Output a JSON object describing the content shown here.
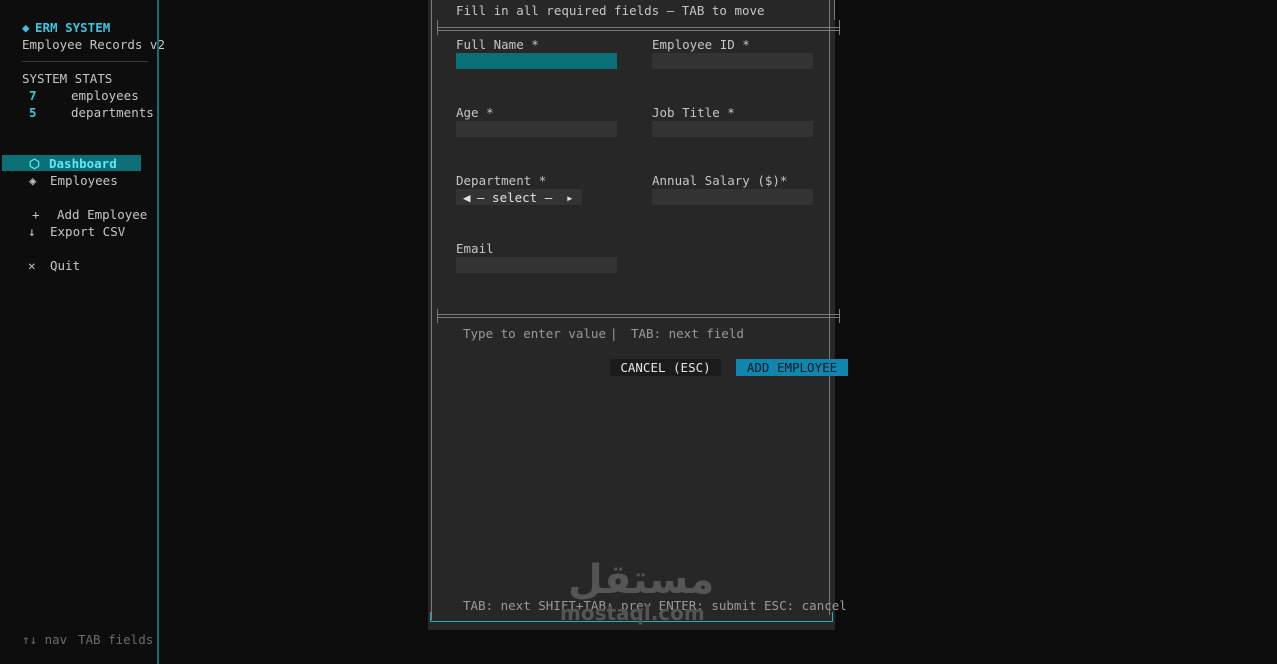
{
  "sidebar": {
    "brand_icon": "◆",
    "brand_title": "ERM SYSTEM",
    "subtitle": "Employee Records v2",
    "stats_heading": "SYSTEM STATS",
    "stats": [
      {
        "value": "7",
        "label": "employees"
      },
      {
        "value": "5",
        "label": "departments"
      }
    ],
    "nav": [
      {
        "icon": "⬡",
        "label": "Dashboard",
        "active": true
      },
      {
        "icon": "◈",
        "label": "Employees",
        "active": false
      }
    ],
    "actions": [
      {
        "icon": "+",
        "label": "Add Employee"
      },
      {
        "icon": "↓",
        "label": "Export CSV"
      },
      {
        "icon": "✕",
        "label": "Quit"
      }
    ],
    "footer_nav": "↑↓ nav",
    "footer_tab": "TAB fields"
  },
  "modal": {
    "instruction": "Fill in all required fields — TAB to move",
    "fields": {
      "full_name": {
        "label": "Full Name *",
        "value": ""
      },
      "employee_id": {
        "label": "Employee ID *",
        "value": ""
      },
      "age": {
        "label": "Age *",
        "value": ""
      },
      "job_title": {
        "label": "Job Title *",
        "value": ""
      },
      "department": {
        "label": "Department *",
        "value": "– select –"
      },
      "salary": {
        "label": "Annual Salary ($)*",
        "value": ""
      },
      "email": {
        "label": "Email",
        "value": ""
      }
    },
    "hint_left": "Type to enter value",
    "hint_divider": "|",
    "hint_right": "TAB: next field",
    "cancel_label": "CANCEL (ESC)",
    "add_label": "ADD EMPLOYEE",
    "footer_keys": "TAB: next  SHIFT+TAB: prev  ENTER: submit  ESC: cancel"
  },
  "watermark": {
    "arabic": "مستقل",
    "latin": "mostaql.com"
  },
  "colors": {
    "accent": "#38c6e3",
    "focus_bg": "#0b6f76",
    "primary_button": "#0f86ad"
  }
}
